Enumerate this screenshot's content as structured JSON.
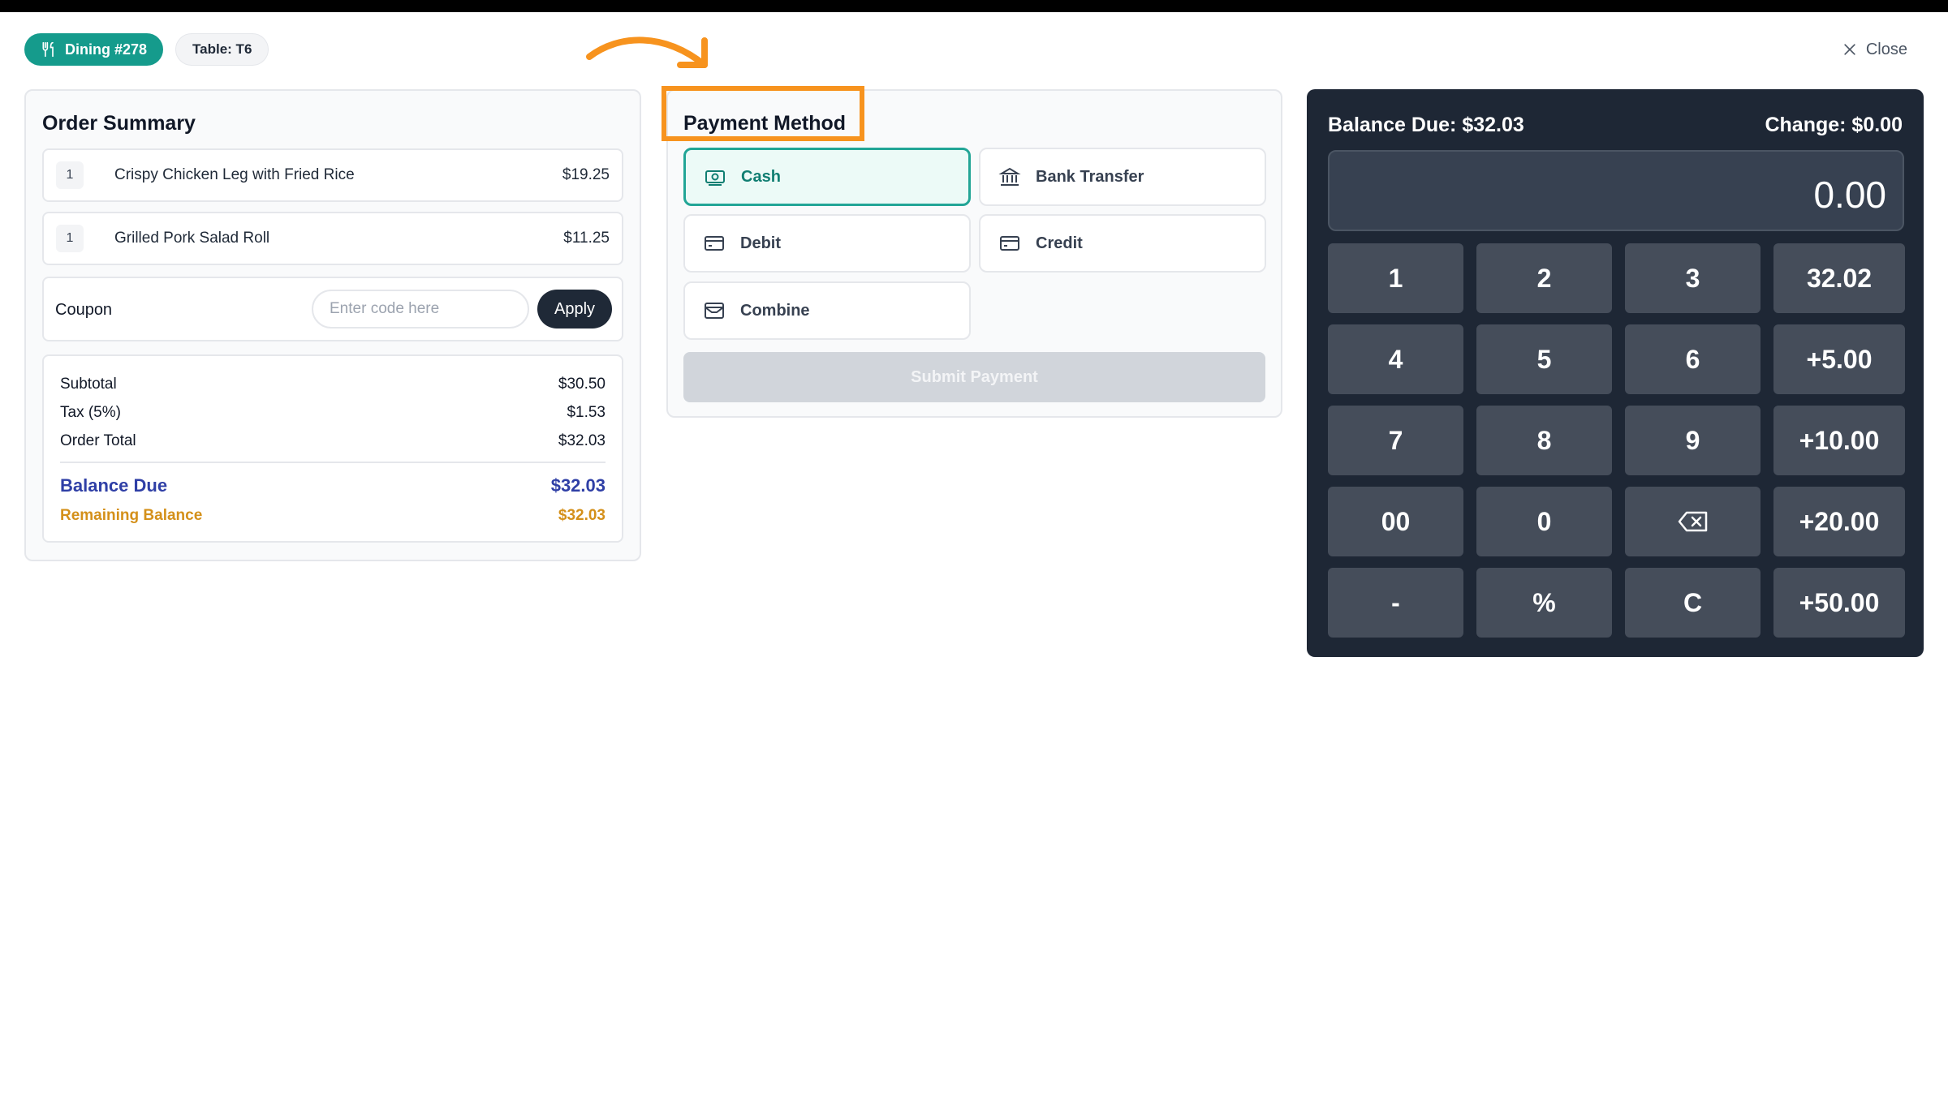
{
  "header": {
    "dining_label": "Dining #278",
    "table_label": "Table: T6",
    "close_label": "Close"
  },
  "order_summary": {
    "title": "Order Summary",
    "items": [
      {
        "qty": "1",
        "name": "Crispy Chicken Leg with Fried Rice",
        "price": "$19.25"
      },
      {
        "qty": "1",
        "name": "Grilled Pork Salad Roll",
        "price": "$11.25"
      }
    ],
    "coupon": {
      "label": "Coupon",
      "placeholder": "Enter code here",
      "apply_label": "Apply"
    },
    "totals": {
      "subtotal_label": "Subtotal",
      "subtotal_value": "$30.50",
      "tax_label": "Tax (5%)",
      "tax_value": "$1.53",
      "order_total_label": "Order Total",
      "order_total_value": "$32.03",
      "balance_due_label": "Balance Due",
      "balance_due_value": "$32.03",
      "remaining_label": "Remaining Balance",
      "remaining_value": "$32.03"
    }
  },
  "payment_method": {
    "title": "Payment Method",
    "options": [
      {
        "label": "Cash",
        "icon": "cash-icon",
        "selected": true
      },
      {
        "label": "Bank Transfer",
        "icon": "bank-icon",
        "selected": false
      },
      {
        "label": "Debit",
        "icon": "card-icon",
        "selected": false
      },
      {
        "label": "Credit",
        "icon": "card-icon",
        "selected": false
      },
      {
        "label": "Combine",
        "icon": "wallet-icon",
        "selected": false
      }
    ],
    "submit_label": "Submit Payment"
  },
  "calculator": {
    "balance_due": "Balance Due: $32.03",
    "change": "Change: $0.00",
    "display": "0.00",
    "keys": [
      "1",
      "2",
      "3",
      "32.02",
      "4",
      "5",
      "6",
      "+5.00",
      "7",
      "8",
      "9",
      "+10.00",
      "00",
      "0",
      "backspace",
      "+20.00",
      "-",
      "%",
      "C",
      "+50.00"
    ]
  },
  "colors": {
    "accent": "#159b8c",
    "highlight": "#f7931e",
    "balance_due": "#2f3fa6",
    "remaining": "#d4901a",
    "calc_bg": "#1e2735"
  }
}
